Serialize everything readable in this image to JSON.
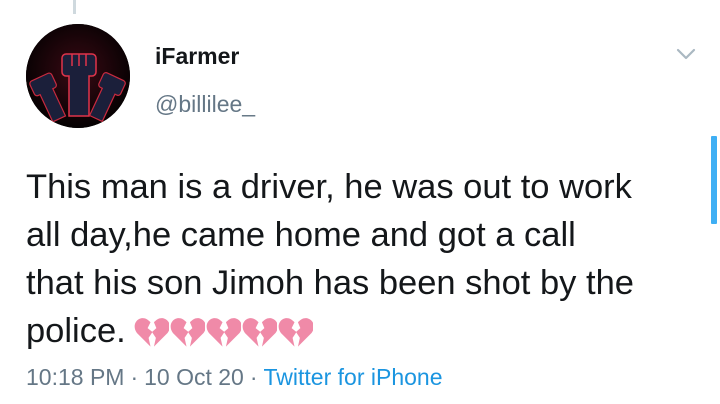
{
  "tweet": {
    "display_name": "iFarmer",
    "handle": "@billilee_",
    "text_lines": [
      "This man is a driver, he was out to work",
      "all day,he came home and got a call",
      "that his son Jimoh has been shot by the",
      "police."
    ],
    "emoji": {
      "name": "broken-heart",
      "count": 5,
      "color": "#f08aa8"
    },
    "time": "10:18 PM",
    "date": "10 Oct 20",
    "separator": "·",
    "source": "Twitter for iPhone"
  },
  "icons": {
    "caret": "chevron-down-icon"
  },
  "colors": {
    "text": "#14171a",
    "secondary": "#657786",
    "link": "#1b95e0",
    "accent": "#1da1f2"
  }
}
